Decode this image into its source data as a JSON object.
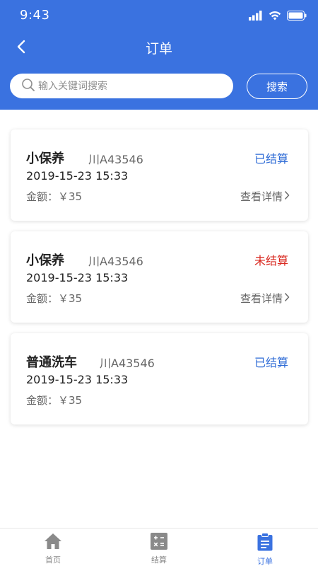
{
  "status_bar": {
    "time": "9:43"
  },
  "header": {
    "title": "订单"
  },
  "search": {
    "placeholder": "输入关键词搜索",
    "value": "",
    "button_label": "搜索"
  },
  "orders": [
    {
      "service": "小保养",
      "plate": "川A43546",
      "status": "已结算",
      "datetime": "2019-15-23 15:33",
      "amount": "金额：￥35",
      "detail_label": "查看详情"
    },
    {
      "service": "小保养",
      "plate": "川A43546",
      "status": "未结算",
      "datetime": "2019-15-23 15:33",
      "amount": "金额：￥35",
      "detail_label": "查看详情"
    },
    {
      "service": "普通洗车",
      "plate": "川A43546",
      "status": "已结算",
      "datetime": "2019-15-23 15:33",
      "amount": "金额：￥35"
    }
  ],
  "tabs": [
    {
      "label": "首页",
      "icon": "home-icon"
    },
    {
      "label": "结算",
      "icon": "calculator-icon"
    },
    {
      "label": "订单",
      "icon": "clipboard-icon"
    }
  ],
  "colors": {
    "primary": "#3a72e0",
    "settled": "#2e6bd6",
    "unsettled": "#d9281f",
    "tab_inactive": "#8a8a8a"
  }
}
